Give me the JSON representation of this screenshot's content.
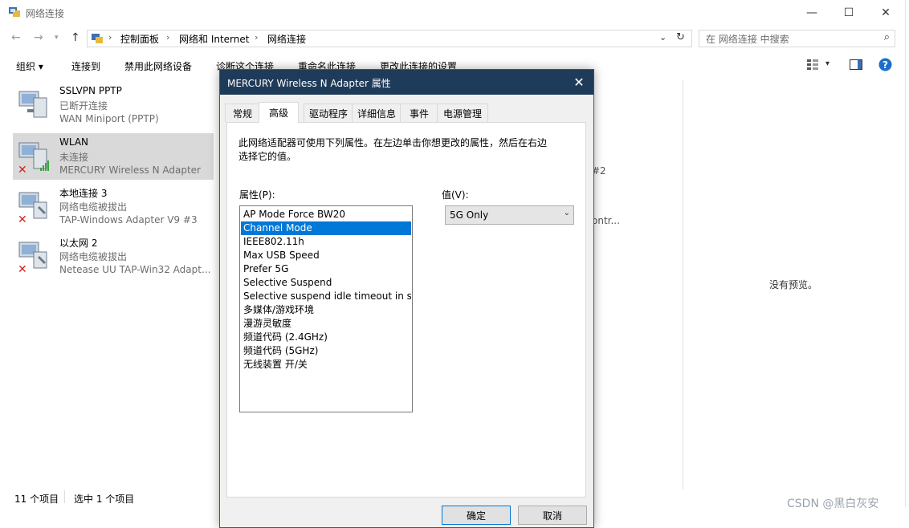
{
  "window": {
    "title": "网络连接"
  },
  "nav": {
    "breadcrumbs": [
      "控制面板",
      "网络和 Internet",
      "网络连接"
    ],
    "search_placeholder": "在 网络连接 中搜索"
  },
  "commands": [
    "组织 ▾",
    "连接到",
    "禁用此网络设备",
    "诊断这个连接",
    "重命名此连接",
    "更改此连接的设置"
  ],
  "connections": [
    {
      "name": "SSLVPN PPTP",
      "status": "已断开连接",
      "device": "WAN Miniport (PPTP)",
      "error": false,
      "signal": false
    },
    {
      "name": "WLAN",
      "status": "未连接",
      "device": "MERCURY Wireless N Adapter",
      "error": true,
      "signal": true
    },
    {
      "name": "本地连接 3",
      "status": "网络电缆被拔出",
      "device": "TAP-Windows Adapter V9 #3",
      "error": true,
      "signal": false
    },
    {
      "name": "以太网 2",
      "status": "网络电缆被拔出",
      "device": "Netease UU TAP-Win32 Adapt...",
      "error": true,
      "signal": false
    }
  ],
  "partial_text": [
    "#2",
    "ontr..."
  ],
  "preview": {
    "empty_text": "没有预览。"
  },
  "status_bar": {
    "items_count": "11 个项目",
    "selected": "选中 1 个项目"
  },
  "dialog": {
    "title": "MERCURY Wireless N Adapter 属性",
    "tabs": [
      "常规",
      "高级",
      "驱动程序",
      "详细信息",
      "事件",
      "电源管理"
    ],
    "active_tab": "高级",
    "description": "此网络适配器可使用下列属性。在左边单击你想更改的属性，然后在右边选择它的值。",
    "property_label": "属性(P):",
    "value_label": "值(V):",
    "properties": [
      "AP Mode Force BW20",
      "Channel Mode",
      "IEEE802.11h",
      "Max USB Speed",
      "Prefer 5G",
      "Selective Suspend",
      "Selective suspend idle timeout in ser",
      "多媒体/游戏环境",
      "漫游灵敏度",
      "频道代码 (2.4GHz)",
      "频道代码 (5GHz)",
      "无线装置 开/关"
    ],
    "selected_property": "Channel Mode",
    "value": "5G Only",
    "ok_label": "确定",
    "cancel_label": "取消"
  },
  "watermark": "CSDN @黑白灰安",
  "colors": {
    "dialog_title_bg": "#1f3b5a",
    "selection": "#0078d7",
    "help": "#1a6fc9",
    "error": "#d42020",
    "signal": "#3aa53a"
  }
}
